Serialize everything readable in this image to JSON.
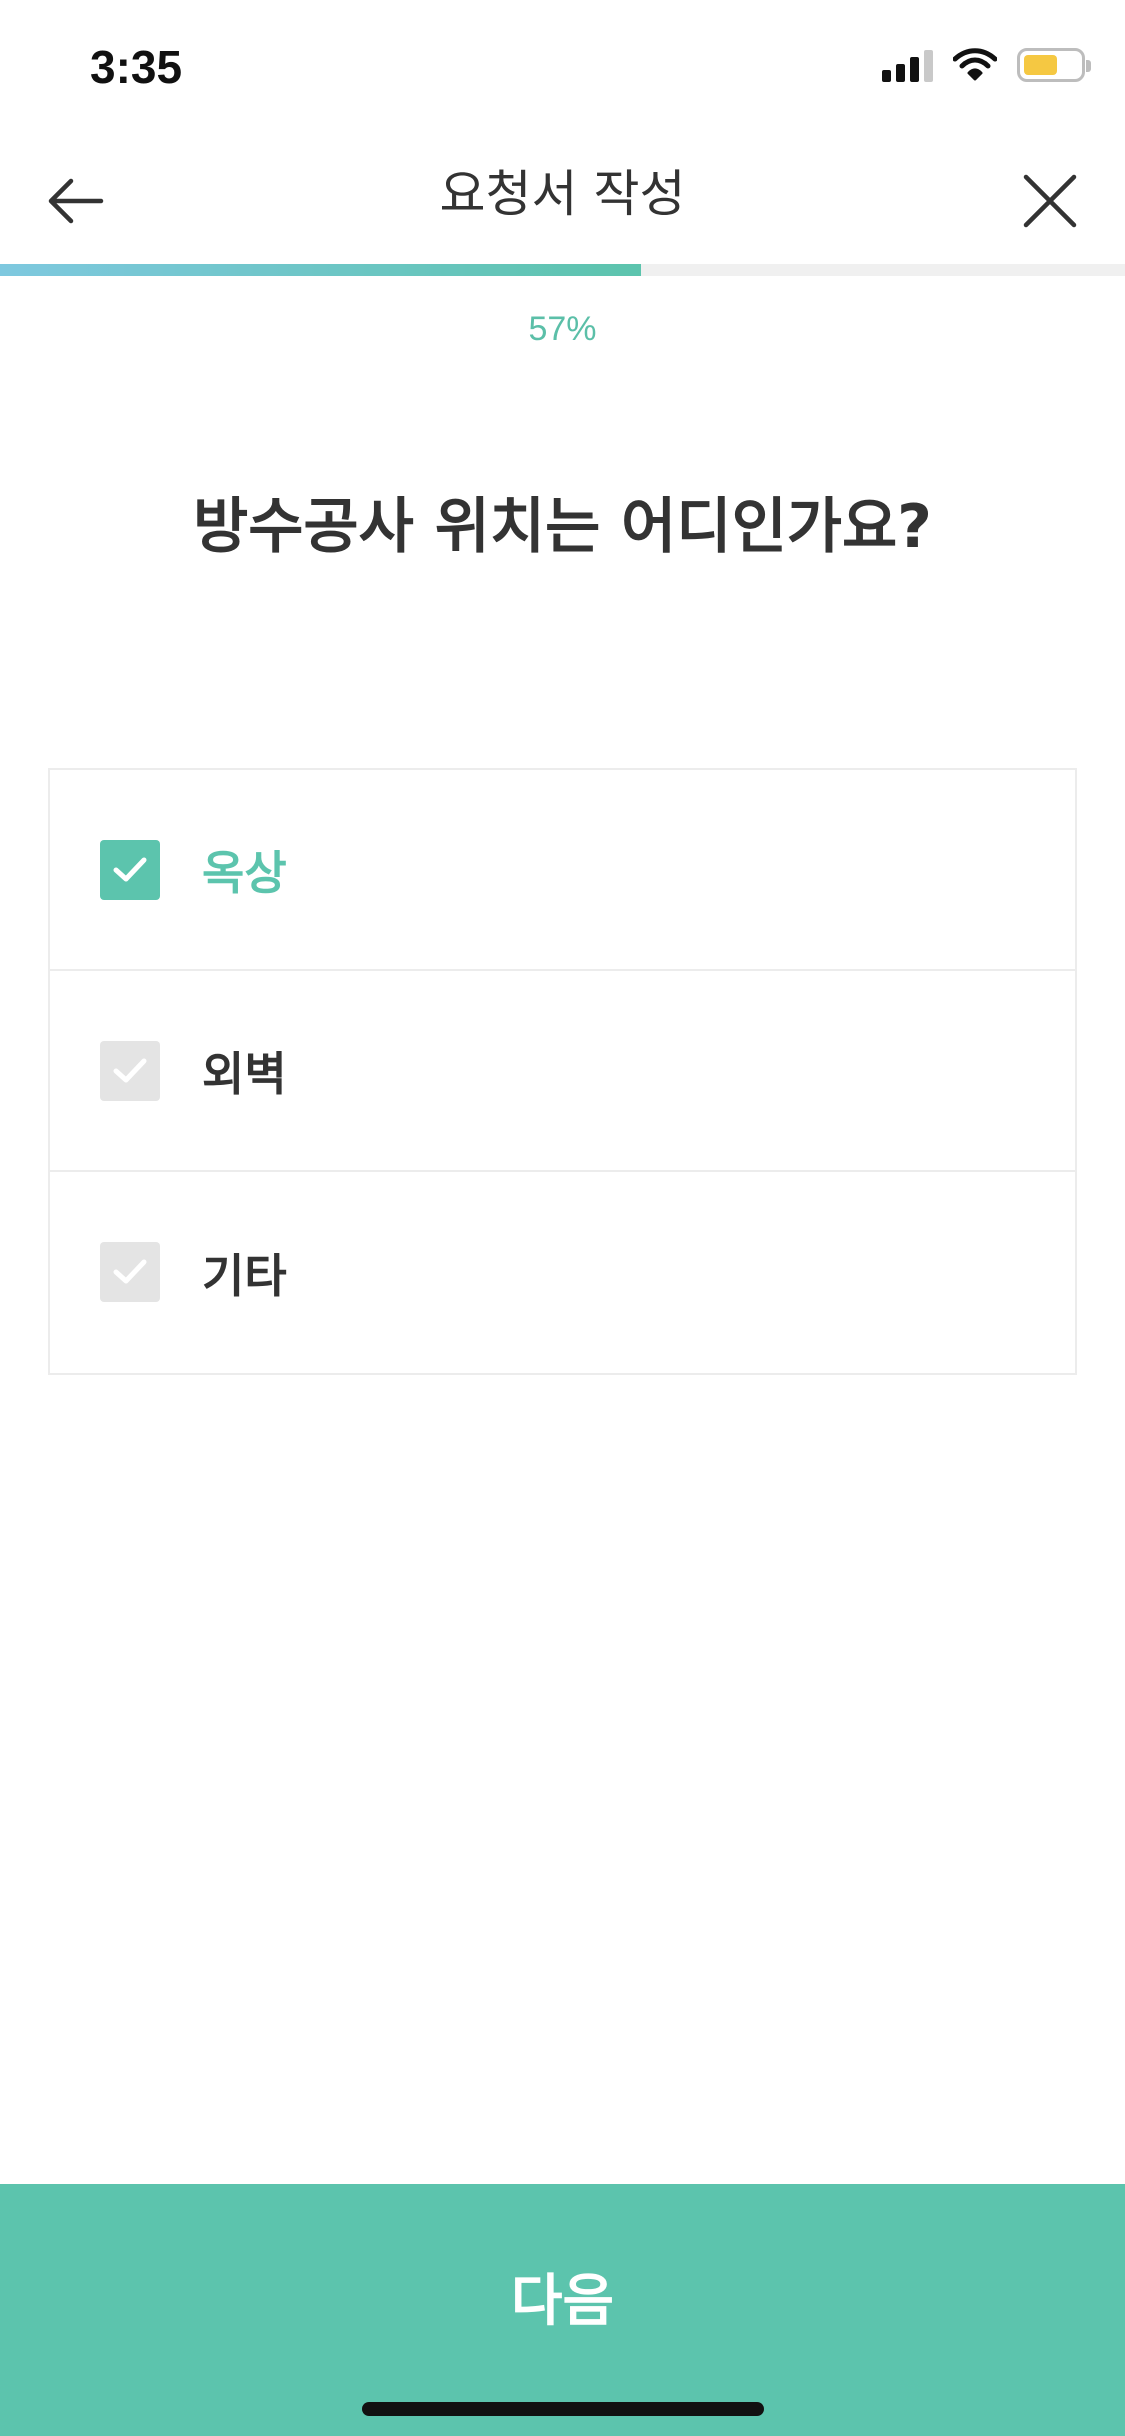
{
  "status_bar": {
    "time": "3:35",
    "icons": [
      "cellular-signal-icon",
      "wifi-icon",
      "battery-icon"
    ]
  },
  "header": {
    "title": "요청서 작성",
    "back_icon": "arrow-left-icon",
    "close_icon": "close-icon"
  },
  "progress": {
    "percent": 57,
    "label": "57%"
  },
  "question": "방수공사 위치는 어디인가요?",
  "options": [
    {
      "label": "옥상",
      "checked": true
    },
    {
      "label": "외벽",
      "checked": false
    },
    {
      "label": "기타",
      "checked": false
    }
  ],
  "next_button": {
    "label": "다음"
  },
  "colors": {
    "accent": "#5cc4ad",
    "progress_start": "#7ec8df",
    "unchecked": "#e4e4e4",
    "text": "#333333"
  }
}
